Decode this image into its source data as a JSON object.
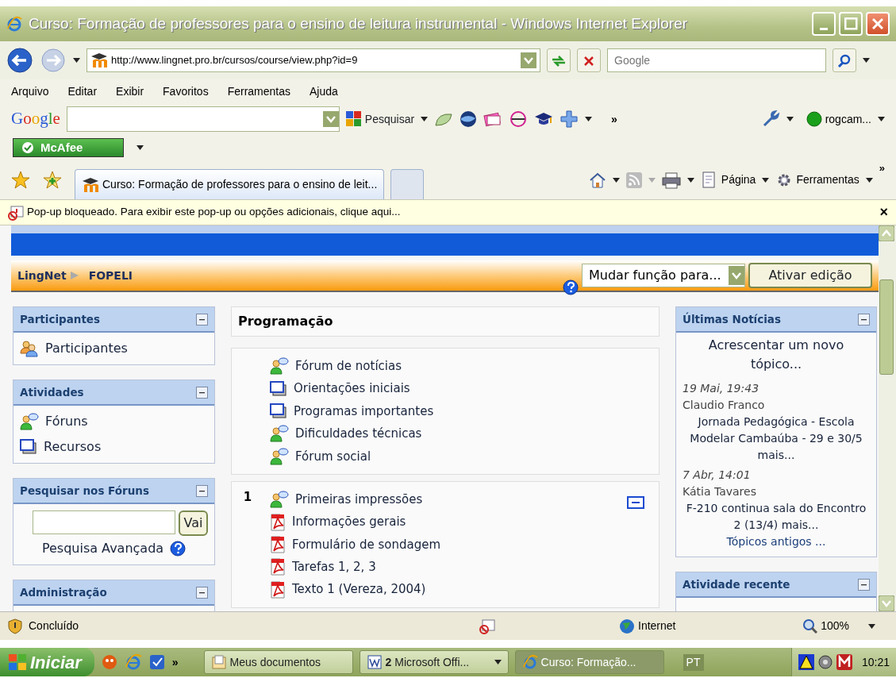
{
  "window": {
    "title": "Curso: Formação de professores para o ensino de leitura instrumental - Windows Internet Explorer"
  },
  "address_bar": {
    "url": "http://www.lingnet.pro.br/cursos/course/view.php?id=9",
    "search_placeholder": "Google"
  },
  "menu": [
    "Arquivo",
    "Editar",
    "Exibir",
    "Favoritos",
    "Ferramentas",
    "Ajuda"
  ],
  "google_toolbar": {
    "logo": "Google",
    "search_button": "Pesquisar",
    "more": "»",
    "account": "rogcam..."
  },
  "mcafee": {
    "label": "McAfee"
  },
  "tabs": [
    {
      "label": "Curso: Formação de professores para o ensino de leit...",
      "selected": true
    }
  ],
  "command_bar": {
    "items": [
      "Página",
      "Ferramentas"
    ],
    "more": "»"
  },
  "info_bar": {
    "text": "Pop-up bloqueado. Para exibir este pop-up ou opções adicionais, clique aqui...",
    "close": "×"
  },
  "page": {
    "breadcrumb": [
      "LingNet",
      "FOPELI"
    ],
    "role_select": "Mudar função para...",
    "edit_button": "Ativar edição",
    "left_blocks": [
      {
        "title": "Participantes",
        "kind": "list",
        "items": [
          {
            "label": "Participantes",
            "kind": "participants"
          }
        ]
      },
      {
        "title": "Atividades",
        "kind": "list",
        "items": [
          {
            "label": "Fóruns",
            "kind": "forum"
          },
          {
            "label": "Recursos",
            "kind": "resource"
          }
        ]
      },
      {
        "title": "Pesquisar nos Fóruns",
        "kind": "search",
        "button": "Vai",
        "link": "Pesquisa Avançada"
      },
      {
        "title": "Administração",
        "kind": "empty"
      }
    ],
    "main": {
      "title": "Programação",
      "sections": [
        {
          "items": [
            {
              "label": "Fórum de notícias",
              "kind": "forum"
            },
            {
              "label": "Orientações iniciais",
              "kind": "resource"
            },
            {
              "label": "Programas importantes",
              "kind": "resource"
            },
            {
              "label": "Dificuldades técnicas",
              "kind": "forum"
            },
            {
              "label": "Fórum social",
              "kind": "forum"
            }
          ]
        },
        {
          "number": "1",
          "items": [
            {
              "label": "Primeiras impressões",
              "kind": "forum"
            },
            {
              "label": "Informações gerais",
              "kind": "pdf"
            },
            {
              "label": "Formulário de sondagem",
              "kind": "pdf"
            },
            {
              "label": "Tarefas 1, 2, 3",
              "kind": "pdf"
            },
            {
              "label": "Texto 1 (Vereza, 2004)",
              "kind": "pdf"
            }
          ]
        }
      ]
    },
    "news": {
      "title": "Últimas Notícias",
      "add_link": "Acrescentar um novo tópico...",
      "posts": [
        {
          "date": "19 Mai, 19:43",
          "author": "Claudio Franco",
          "text": "Jornada Pedagógica - Escola Modelar Cambaúba - 29 e 30/5 mais..."
        },
        {
          "date": "7 Abr, 14:01",
          "author": "Kátia Tavares",
          "text": "F-210 continua sala do Encontro 2 (13/4) mais..."
        }
      ],
      "older_link": "Tópicos antigos ..."
    },
    "recent": {
      "title": "Atividade recente"
    }
  },
  "status_bar": {
    "status": "Concluído",
    "zone": "Internet",
    "zoom": "100%"
  },
  "taskbar": {
    "start": "Iniciar",
    "more": "»",
    "buttons": [
      {
        "label": "Meus documentos",
        "selected": false,
        "kind": "folder"
      },
      {
        "label": "**2** Microsoft Offi...",
        "selected": false,
        "kind": "word"
      },
      {
        "label": "Curso: Formação...",
        "selected": true,
        "kind": "ie"
      }
    ],
    "language": "PT",
    "clock": "10:21"
  }
}
